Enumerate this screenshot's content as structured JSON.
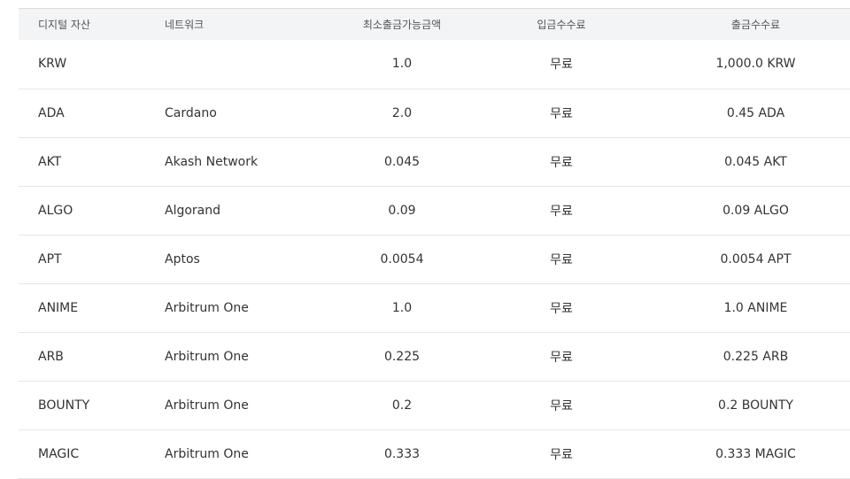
{
  "table": {
    "headers": {
      "asset": "디지털 자산",
      "network": "네트워크",
      "min_withdrawal": "최소출금가능금액",
      "deposit_fee": "입금수수료",
      "withdrawal_fee": "출금수수료"
    },
    "rows": [
      {
        "asset": "KRW",
        "network": "",
        "min_withdrawal": "1.0",
        "deposit_fee": "무료",
        "withdrawal_fee": "1,000.0 KRW"
      },
      {
        "asset": "ADA",
        "network": "Cardano",
        "min_withdrawal": "2.0",
        "deposit_fee": "무료",
        "withdrawal_fee": "0.45 ADA"
      },
      {
        "asset": "AKT",
        "network": "Akash Network",
        "min_withdrawal": "0.045",
        "deposit_fee": "무료",
        "withdrawal_fee": "0.045 AKT"
      },
      {
        "asset": "ALGO",
        "network": "Algorand",
        "min_withdrawal": "0.09",
        "deposit_fee": "무료",
        "withdrawal_fee": "0.09 ALGO"
      },
      {
        "asset": "APT",
        "network": "Aptos",
        "min_withdrawal": "0.0054",
        "deposit_fee": "무료",
        "withdrawal_fee": "0.0054 APT"
      },
      {
        "asset": "ANIME",
        "network": "Arbitrum One",
        "min_withdrawal": "1.0",
        "deposit_fee": "무료",
        "withdrawal_fee": "1.0 ANIME"
      },
      {
        "asset": "ARB",
        "network": "Arbitrum One",
        "min_withdrawal": "0.225",
        "deposit_fee": "무료",
        "withdrawal_fee": "0.225 ARB"
      },
      {
        "asset": "BOUNTY",
        "network": "Arbitrum One",
        "min_withdrawal": "0.2",
        "deposit_fee": "무료",
        "withdrawal_fee": "0.2 BOUNTY"
      },
      {
        "asset": "MAGIC",
        "network": "Arbitrum One",
        "min_withdrawal": "0.333",
        "deposit_fee": "무료",
        "withdrawal_fee": "0.333 MAGIC"
      }
    ]
  }
}
